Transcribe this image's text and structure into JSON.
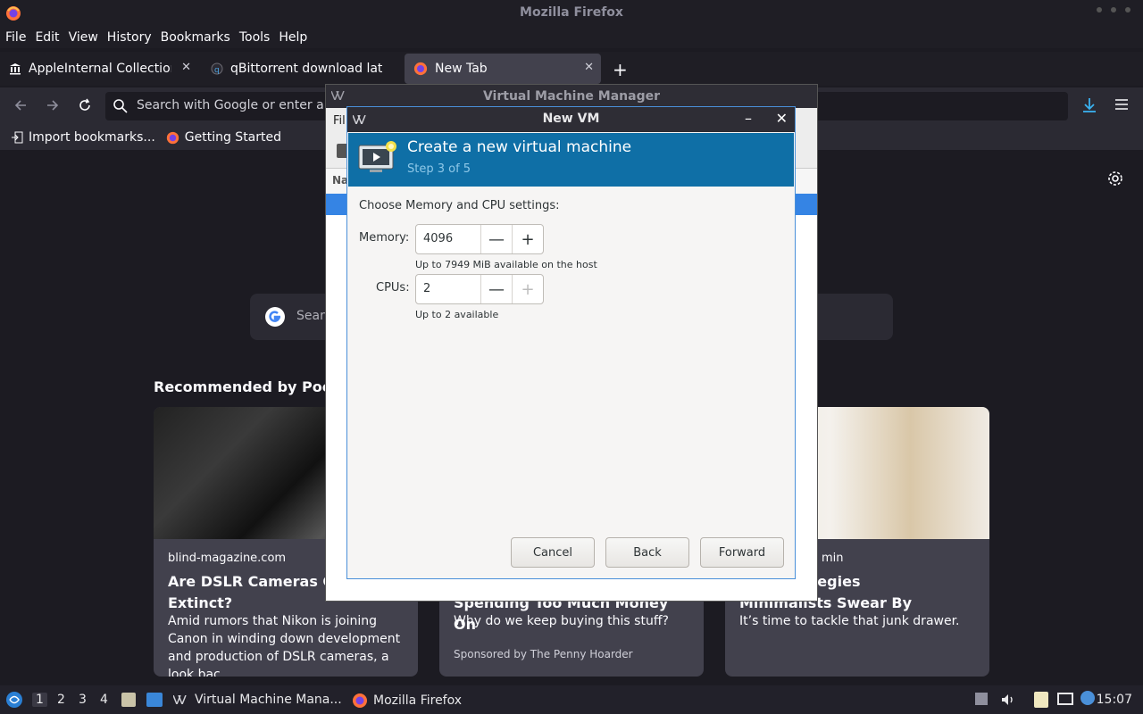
{
  "window_title": "Mozilla Firefox",
  "menu": [
    "File",
    "Edit",
    "View",
    "History",
    "Bookmarks",
    "Tools",
    "Help"
  ],
  "tabs": [
    {
      "label": "AppleInternal Collection",
      "active": false
    },
    {
      "label": "qBittorrent download late",
      "active": false
    },
    {
      "label": "New Tab",
      "active": true
    }
  ],
  "urlbar": {
    "placeholder": "Search with Google or enter a"
  },
  "bookmarks": [
    "Import bookmarks...",
    "Getting Started"
  ],
  "newtab": {
    "search_placeholder": "Sear",
    "recommended_title": "Recommended by Pocke",
    "cards": [
      {
        "source": "blind-magazine.com",
        "headline": "Are DSLR Cameras Go Extinct?",
        "excerpt": "Amid rumors that Nikon is joining Canon in winding down development and production of DSLR cameras, a look bac..."
      },
      {
        "source": "",
        "headline": "Spending Too Much Money On",
        "excerpt": "Why do we keep buying this stuff?",
        "sponsor": "Sponsored by The Penny Hoarder"
      },
      {
        "source": "min",
        "headline": "ring Strategies Minimalists Swear By",
        "excerpt": "It’s time to tackle that junk drawer."
      }
    ]
  },
  "vmm": {
    "title": "Virtual Machine Manager",
    "menu_partial": "Fil",
    "column_partial": "Na"
  },
  "newvm": {
    "title": "New VM",
    "banner_title": "Create a new virtual machine",
    "banner_step": "Step 3 of 5",
    "section_label": "Choose Memory and CPU settings:",
    "memory": {
      "label": "Memory:",
      "value": "4096",
      "hint": "Up to 7949 MiB available on the host"
    },
    "cpus": {
      "label": "CPUs:",
      "value": "2",
      "hint": "Up to 2 available"
    },
    "buttons": {
      "cancel": "Cancel",
      "back": "Back",
      "forward": "Forward"
    }
  },
  "taskbar": {
    "workspaces": [
      "1",
      "2",
      "3",
      "4"
    ],
    "active_workspace": "1",
    "items": [
      "Virtual Machine Mana...",
      "Mozilla Firefox"
    ],
    "clock": "15:07"
  },
  "colors": {
    "accent": "#0f6fa6",
    "selection": "#3584e4",
    "firefox_bg": "#1c1b22"
  }
}
